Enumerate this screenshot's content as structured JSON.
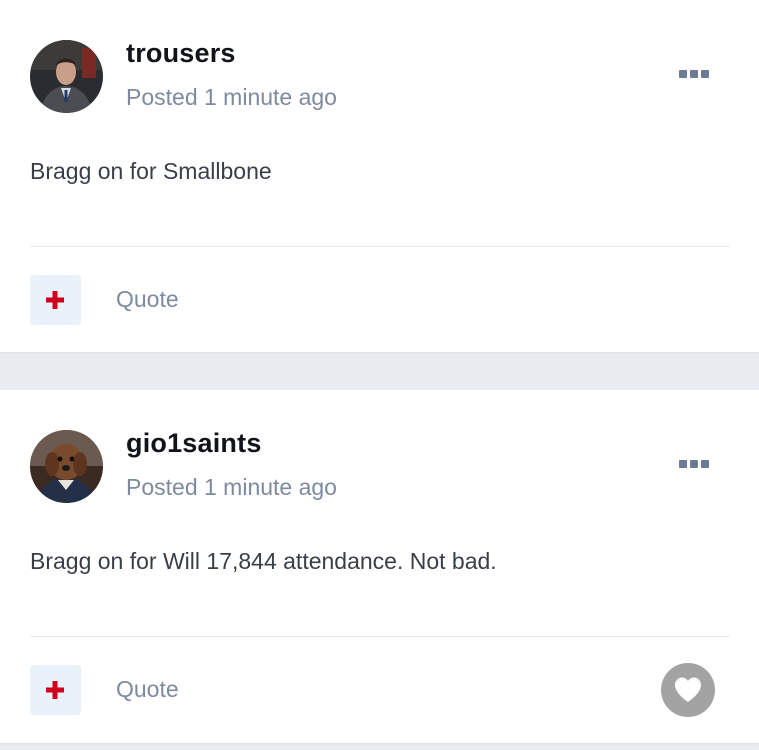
{
  "posts": [
    {
      "username": "trousers",
      "posted": "Posted 1 minute ago",
      "body": "Bragg on for Smallbone",
      "quote_label": "Quote",
      "has_like": false
    },
    {
      "username": "gio1saints",
      "posted": "Posted 1 minute ago",
      "body": "Bragg on for Will 17,844 attendance. Not bad.",
      "quote_label": "Quote",
      "has_like": true
    }
  ],
  "icons": {
    "more": "ellipsis-icon",
    "add_reaction": "plus-icon",
    "like": "heart-icon"
  },
  "colors": {
    "accent_red": "#d0021b",
    "muted_text": "#7d8aa0",
    "button_bg": "#e9f2fb",
    "like_bg": "#a3a3a3",
    "page_bg": "#e9edf2"
  }
}
